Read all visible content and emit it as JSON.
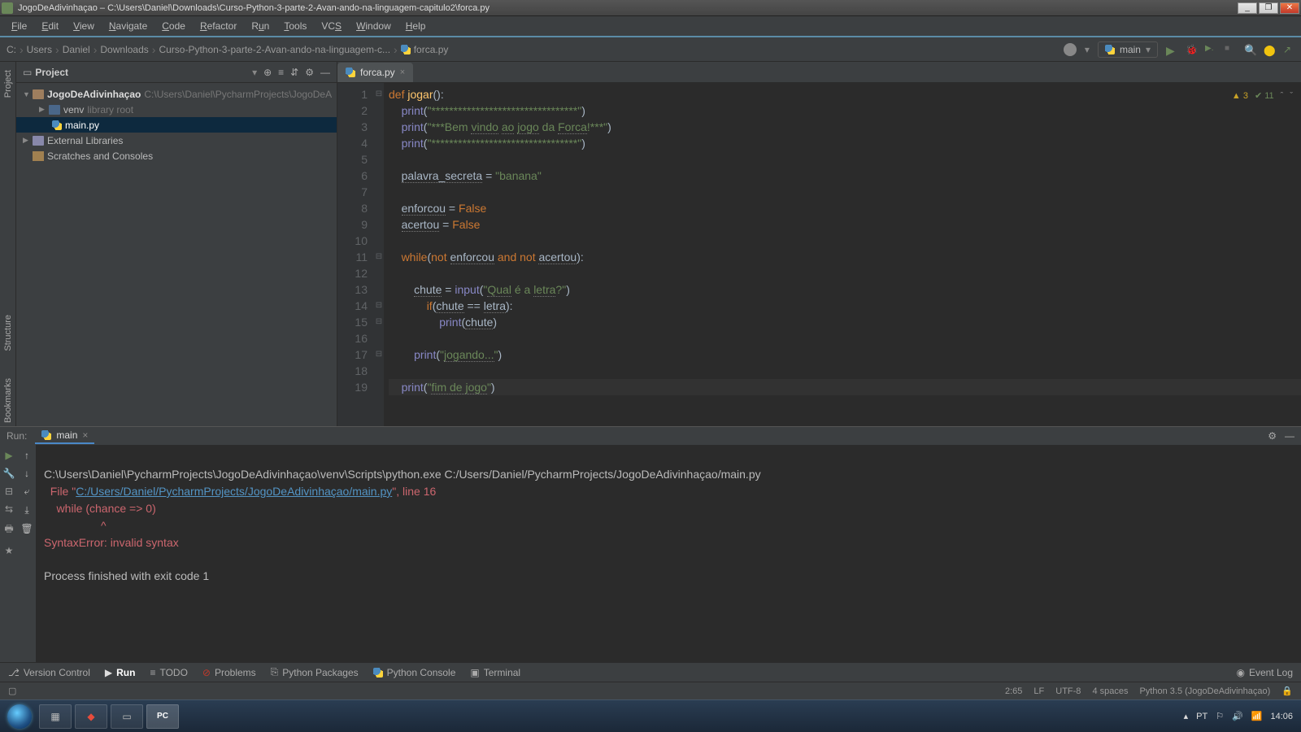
{
  "window": {
    "title": "JogoDeAdivinhaçao – C:\\Users\\Daniel\\Downloads\\Curso-Python-3-parte-2-Avan-ando-na-linguagem-capitulo2\\forca.py"
  },
  "menu": [
    "File",
    "Edit",
    "View",
    "Navigate",
    "Code",
    "Refactor",
    "Run",
    "Tools",
    "VCS",
    "Window",
    "Help"
  ],
  "breadcrumbs": [
    "C:",
    "Users",
    "Daniel",
    "Downloads",
    "Curso-Python-3-parte-2-Avan-ando-na-linguagem-c...",
    "forca.py"
  ],
  "run_config": "main",
  "project_panel": {
    "title": "Project",
    "root": {
      "name": "JogoDeAdivinhaçao",
      "path": "C:\\Users\\Daniel\\PycharmProjects\\JogoDeA"
    },
    "venv": {
      "name": "venv",
      "hint": "library root"
    },
    "file": "main.py",
    "ext_lib": "External Libraries",
    "scratch": "Scratches and Consoles"
  },
  "editor_tab": "forca.py",
  "inspect": {
    "warn": "3",
    "pass": "11"
  },
  "side_tabs": {
    "project": "Project",
    "structure": "Structure",
    "bookmarks": "Bookmarks"
  },
  "code_lines": [
    "def jogar():",
    "    print(\"*********************************\")",
    "    print(\"***Bem vindo ao jogo da Forca!***\")",
    "    print(\"*********************************\")",
    "",
    "    palavra_secreta = \"banana\"",
    "",
    "    enforcou = False",
    "    acertou = False",
    "",
    "    while(not enforcou and not acertou):",
    "",
    "        chute = input(\"Qual é a letra?\")",
    "            if(chute == letra):",
    "                print(chute)",
    "",
    "        print(\"jogando...\")",
    "",
    "    print(\"fim de jogo\")"
  ],
  "run": {
    "label": "Run:",
    "tab": "main",
    "line1": "C:\\Users\\Daniel\\PycharmProjects\\JogoDeAdivinhaçao\\venv\\Scripts\\python.exe C:/Users/Daniel/PycharmProjects/JogoDeAdivinhaçao/main.py",
    "file_prefix": "  File \"",
    "file_link": "C:/Users/Daniel/PycharmProjects/JogoDeAdivinhaçao/main.py",
    "file_suffix": "\", line 16",
    "err1": "    while (chance => 0)",
    "err2": "                  ^",
    "err3": "SyntaxError: invalid syntax",
    "exit": "Process finished with exit code 1"
  },
  "bottom_tabs": {
    "vcs": "Version Control",
    "run": "Run",
    "todo": "TODO",
    "problems": "Problems",
    "packages": "Python Packages",
    "console": "Python Console",
    "terminal": "Terminal",
    "eventlog": "Event Log"
  },
  "status": {
    "pos": "2:65",
    "lf": "LF",
    "enc": "UTF-8",
    "indent": "4 spaces",
    "sdk": "Python 3.5 (JogoDeAdivinhaçao)"
  },
  "tray": {
    "lang": "PT",
    "time": "14:06"
  }
}
